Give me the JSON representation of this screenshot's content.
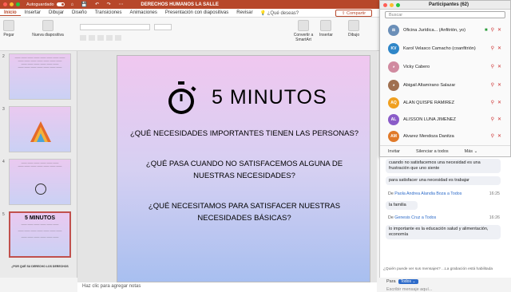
{
  "window": {
    "autosave_label": "Autoguardado",
    "doc_title": "DERECHOS HUMANOS LA SALLE"
  },
  "menubar": {
    "tabs": [
      "Inicio",
      "Insertar",
      "Dibujar",
      "Diseño",
      "Transiciones",
      "Animaciones",
      "Presentación con diapositivas",
      "Revisar"
    ],
    "search": "¿Qué deseas?",
    "share": "Compartir"
  },
  "ribbon": {
    "paste": "Pegar",
    "new_slide": "Nueva diapositiva",
    "convert": "Convertir a SmartArt",
    "insert": "Insertar",
    "draw": "Dibujo"
  },
  "thumbnails": {
    "numbers": [
      "2",
      "3",
      "4",
      "5"
    ],
    "slide5_title": "5 MINUTOS",
    "next_label": "¿POR QUÉ SU DERECHO LOS DERECHOS"
  },
  "slide": {
    "title": "5 MINUTOS",
    "q1": "¿Qué necesidades importantes tienen las personas?",
    "q2": "¿Qué pasa cuando no satisfacemos alguna de nuestras necesidades?",
    "q3": "¿Qué necesitamos para satisfacer nuestras necesidades básicas?"
  },
  "notes": {
    "placeholder": "Haz clic para agregar notas"
  },
  "participants": {
    "title": "Participantes (62)",
    "search_placeholder": "Buscar",
    "list": [
      {
        "name": "Oficina Jurídica... (Anfitrión, yo)",
        "initials": "",
        "color": "#6b8fb8"
      },
      {
        "name": "Karol Velasco Camacho (coanfitrión)",
        "initials": "KV",
        "color": "#2f86c8"
      },
      {
        "name": "Vicky Cabero",
        "initials": "",
        "color": "#d08aa0"
      },
      {
        "name": "Abigail Altamirano Salazar",
        "initials": "",
        "color": "#a07050"
      },
      {
        "name": "ALAN QUISPE RAMIREZ",
        "initials": "AQ",
        "color": "#f0a020"
      },
      {
        "name": "ALISSON LUNA JIMENEZ",
        "initials": "AL",
        "color": "#8a5cc8"
      },
      {
        "name": "Alvarez Mendoza Danitza",
        "initials": "AM",
        "color": "#e07a2a"
      }
    ],
    "invite": "Invitar",
    "mute_all": "Silenciar a todos",
    "more": "Más"
  },
  "chat": {
    "msg1": "cuando no satisfacemos una necesidad es una frustración que uno siente",
    "msg2": "para satisfacer una necesidad es trabajar",
    "from3_prefix": "De",
    "from3_name": "Paola Andrea Alandia Boza a Todos",
    "from3_time": "16:25",
    "msg3": "la familia",
    "from4_prefix": "De",
    "from4_name": "Genesis Cruz a Todos",
    "from4_time": "16:26",
    "msg4": "lo importante es la educación salud y alimentación, economía",
    "hint": "¿Quién puede ver sus mensajes? ...La grabación está habilitada",
    "to_label": "Para",
    "to_value": "Todos",
    "input_placeholder": "Escribir mensaje aquí..."
  }
}
